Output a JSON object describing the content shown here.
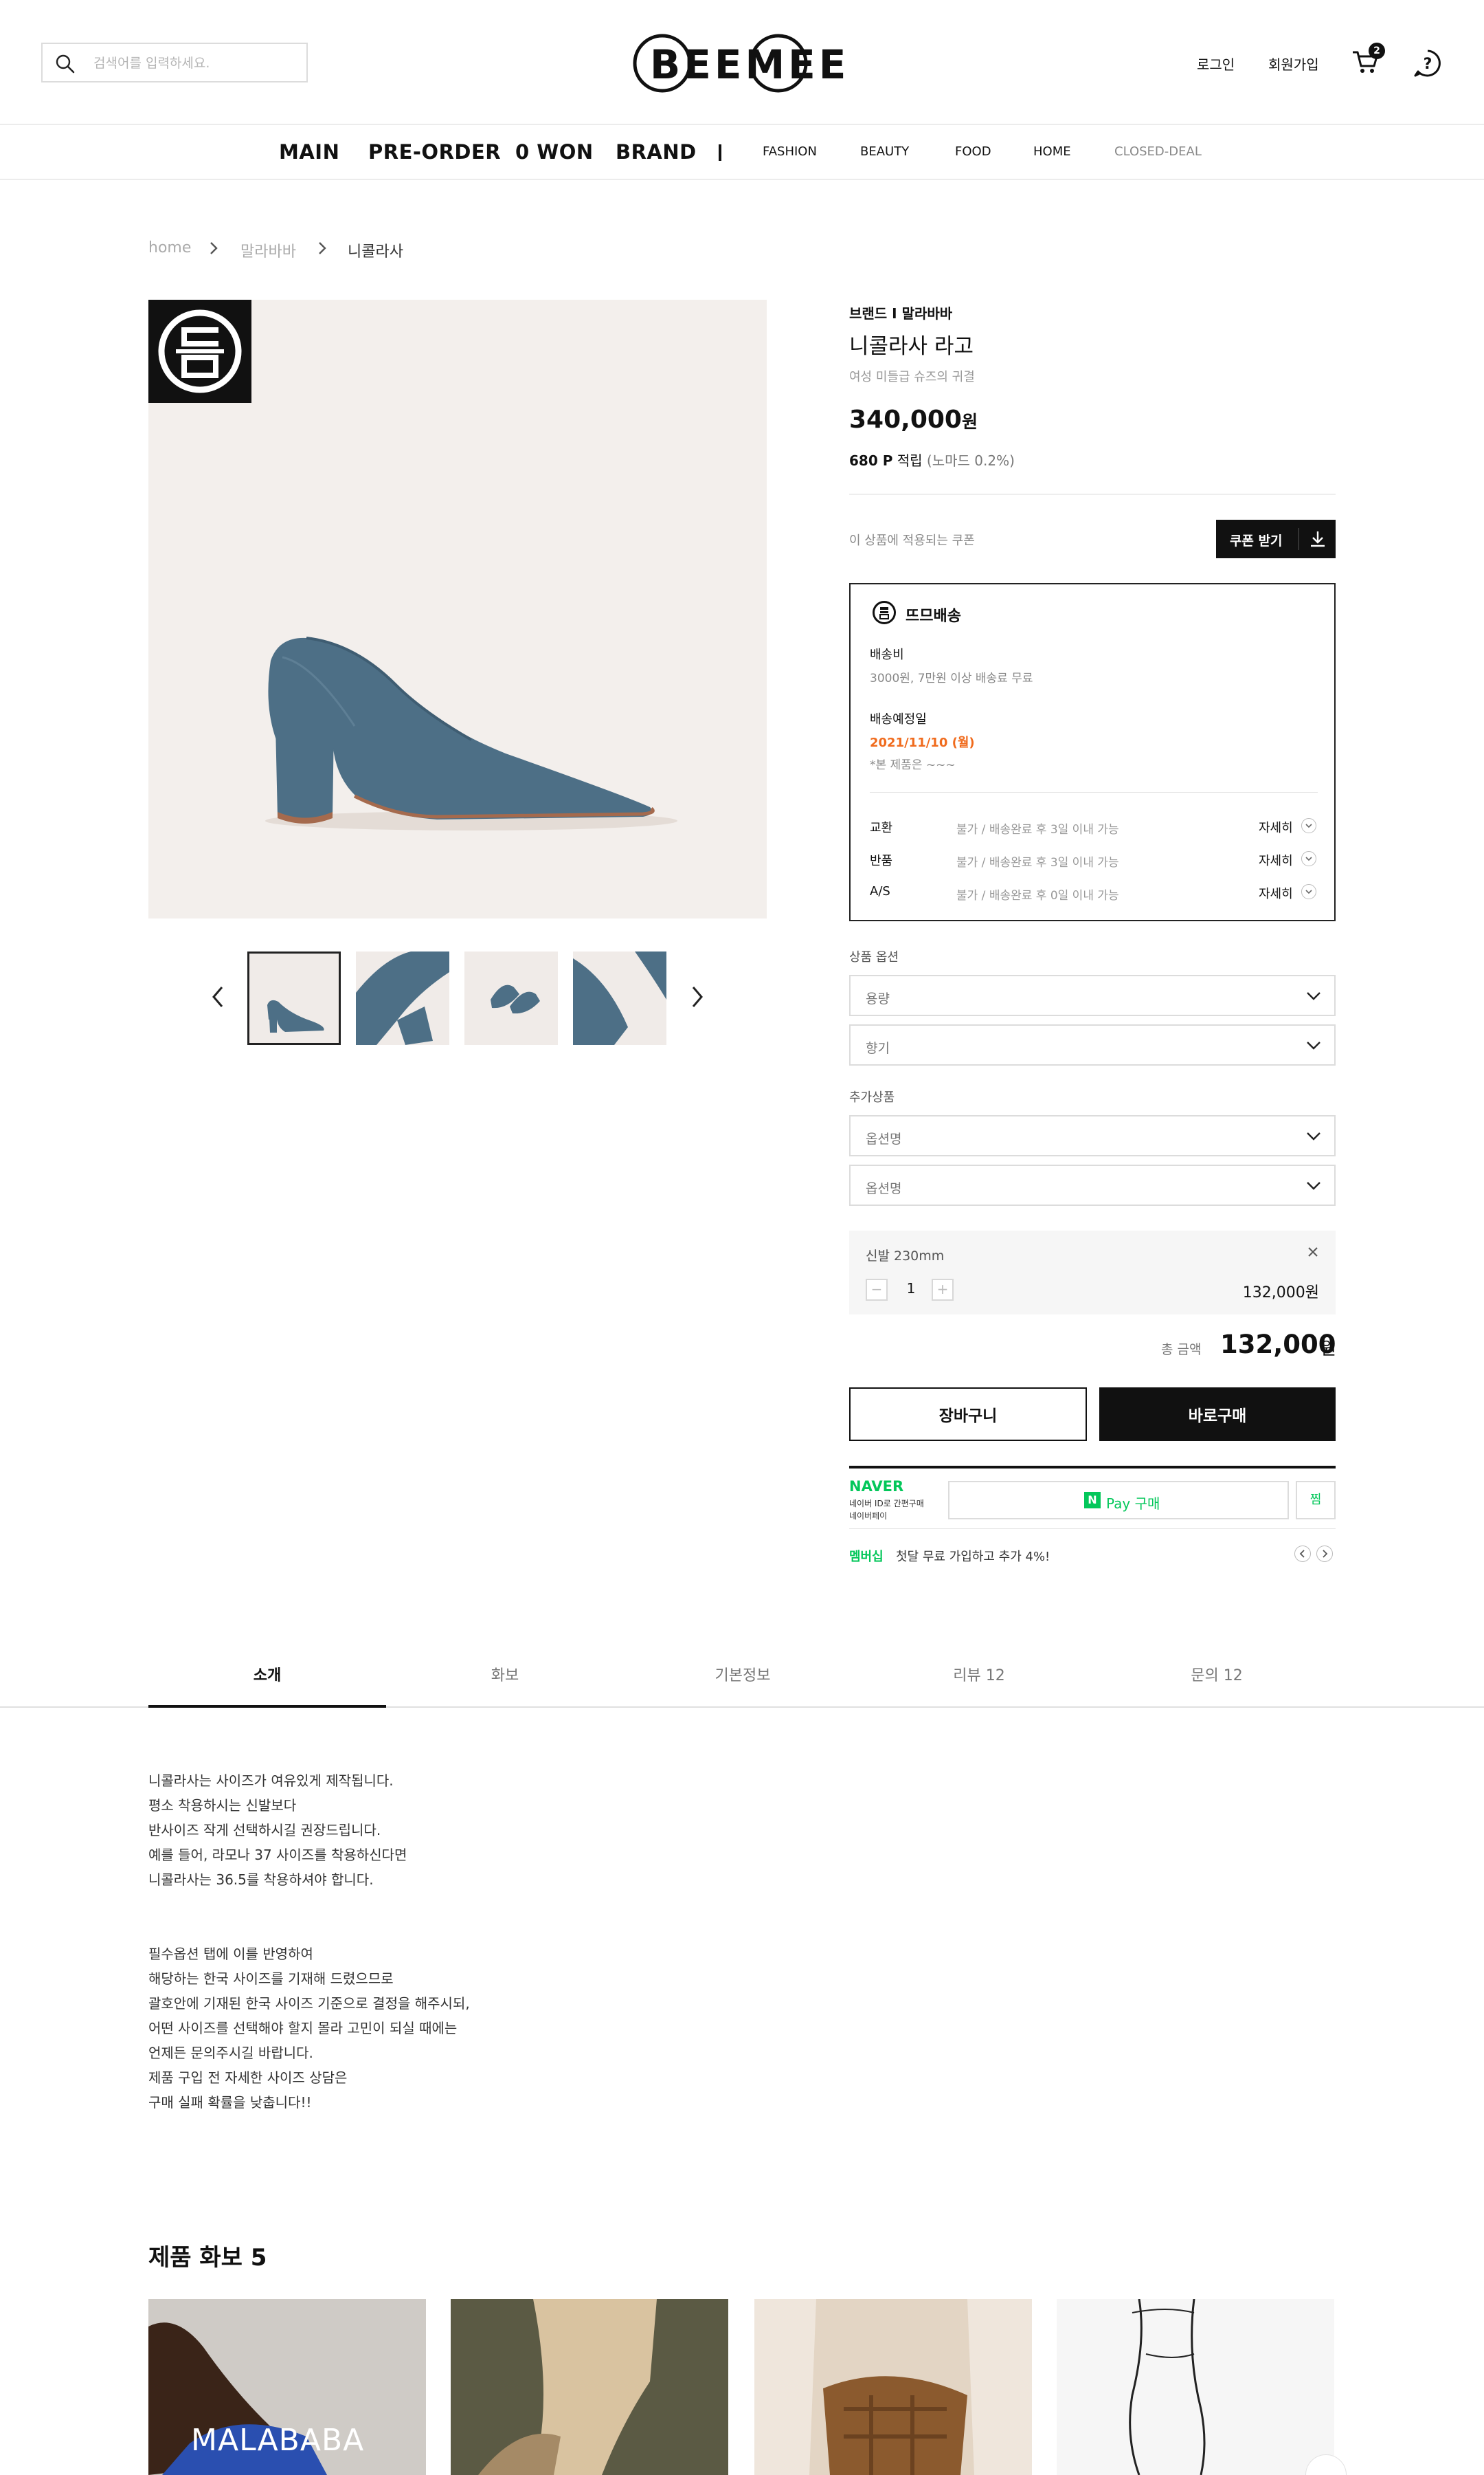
{
  "header": {
    "search": {
      "placeholder": "검색어를 입력하세요."
    },
    "logo_text": "BEEMEE",
    "login": "로그인",
    "signup": "회원가입",
    "cart_count": "2",
    "icons": [
      "search-icon",
      "cart-icon",
      "help-icon"
    ]
  },
  "nav": {
    "main": [
      "MAIN",
      "PRE-ORDER",
      "0 WON",
      "BRAND"
    ],
    "sub": [
      "FASHION",
      "BEAUTY",
      "FOOD",
      "HOME",
      "CLOSED-DEAL"
    ]
  },
  "breadcrumb": [
    "home",
    "말라바바",
    "니콜라사"
  ],
  "product": {
    "brand_line": "브랜드 I 말라바바",
    "name": "니콜라사 라고",
    "description": "여성 미들급 슈즈의 귀결",
    "price": "340,000",
    "price_unit": "원",
    "points": "680 P",
    "points_label": "적립",
    "points_note": "(노마드 0.2%)",
    "coupon_label": "이 상품에 적용되는 쿠폰",
    "coupon_button": "쿠폰 받기"
  },
  "delivery": {
    "title": "뜨므배송",
    "fee_label": "배송비",
    "fee_value": "3000원, 7만원 이상 배송료 무료",
    "date_label": "배송예정일",
    "date_value": "2021/11/10 (월)",
    "date_note": "*본 제품은 ~~~",
    "policies": [
      {
        "label": "교환",
        "value": "불가 / 배송완료 후 3일 이내 가능",
        "link": "자세히"
      },
      {
        "label": "반품",
        "value": "불가 / 배송완료 후 3일 이내 가능",
        "link": "자세히"
      },
      {
        "label": "A/S",
        "value": "불가 / 배송완료 후 0일 이내 가능",
        "link": "자세히"
      }
    ]
  },
  "options": {
    "section_label": "상품 옵션",
    "selects": [
      "용량",
      "향기"
    ],
    "extra_label": "추가상품",
    "extra_selects": [
      "옵션명",
      "옵션명"
    ]
  },
  "chosen": {
    "name": "신발 230mm",
    "minus": "−",
    "qty": "1",
    "plus": "+",
    "price": "132,000원"
  },
  "total": {
    "label": "총 금액",
    "value": "132,000",
    "unit": "원"
  },
  "buttons": {
    "cart": "장바구니",
    "buy": "바로구매"
  },
  "naver": {
    "logo": "NAVER",
    "sub1": "네이버 ID로 간편구매",
    "sub2": "네이버페이",
    "n_mark": "N",
    "pay_label": "Pay 구매",
    "wish": "찜",
    "membership_label": "멤버십",
    "membership_text": "첫달 무료 가입하고 추가 4%!"
  },
  "tabs": [
    "소개",
    "화보",
    "기본정보",
    "리뷰 12",
    "문의 12"
  ],
  "description": {
    "para1": [
      "니콜라사는 사이즈가 여유있게 제작됩니다.",
      "평소 착용하시는 신발보다",
      "반사이즈 작게 선택하시길 권장드립니다.",
      "예를 들어, 라모나 37 사이즈를 착용하신다면",
      "니콜라사는 36.5를 착용하셔야 합니다."
    ],
    "para2": [
      "필수옵션 탭에 이를 반영하여",
      "해당하는 한국 사이즈를 기재해 드렸으므로",
      "괄호안에 기재된 한국 사이즈 기준으로 결정을 해주시되,",
      "어떤 사이즈를 선택해야 할지 몰라 고민이 되실 때에는",
      "언제든 문의주시길 바랍니다.",
      "제품 구입 전 자세한 사이즈 상담은",
      "구매 실패 확률을 낮춥니다!!"
    ]
  },
  "reviews": {
    "title": "제품 화보 5",
    "first_card_text": "MALABABA"
  },
  "colors": {
    "accent_orange": "#f06b1d",
    "naver_green": "#03c75a",
    "shoe_blue": "#4d6f86",
    "black": "#111111"
  }
}
